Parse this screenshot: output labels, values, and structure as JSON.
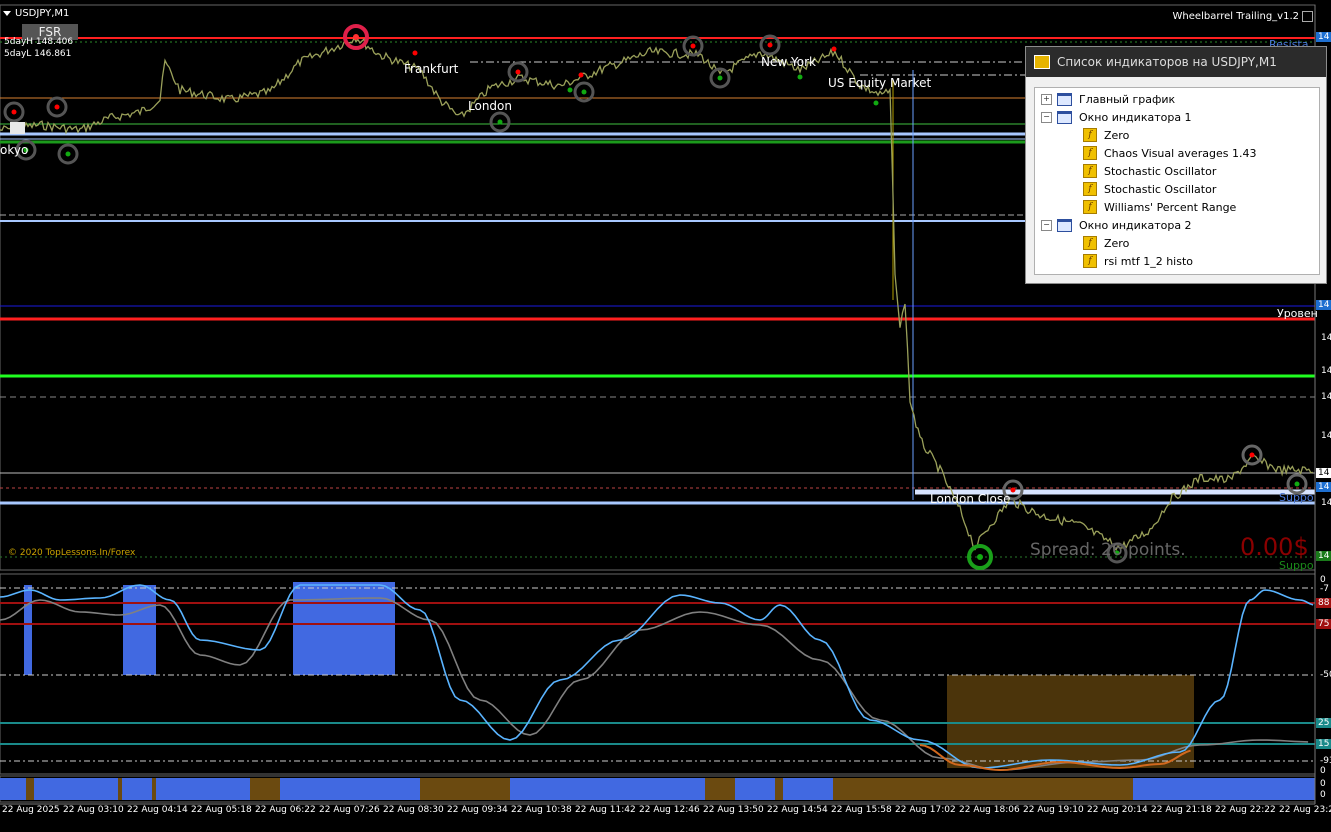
{
  "window": {
    "symbol_title": "USDJPY,M1",
    "fsr_label": "FSR",
    "five_day_high": "5dayH 148.406",
    "five_day_low": "5dayL 146.861",
    "ea_name": "Wheelbarrel Trailing_v1.2",
    "copyright": "© 2020 TopLessons.In/Forex",
    "spread": "Spread: 26 points.",
    "profit": "0.00$"
  },
  "sessions": {
    "tokyo": "okyo",
    "frankfurt": "Frankfurt",
    "london": "London",
    "new_york": "New York",
    "us_equity": "US Equity Market",
    "london_close": "London Close"
  },
  "levels": {
    "resistance": "Resista",
    "uroven": "Уровен",
    "support_1": "Suppo",
    "support_2": "Suppo"
  },
  "price_axis_tags": {
    "t1": "14",
    "t2": "14",
    "t3": "14",
    "t4": "14",
    "t5": "14",
    "t6": "14",
    "t7": "14",
    "t8": "14",
    "t9": "14",
    "t10": "14"
  },
  "sub_axis": [
    "0",
    "-7",
    "88",
    "75",
    "-50",
    "25",
    "15",
    "-93",
    "0",
    "0",
    "0"
  ],
  "indicator_list": {
    "title": "Список индикаторов на USDJPY,M1",
    "items": [
      {
        "label": "Главный график",
        "kind": "window",
        "level": 0
      },
      {
        "label": "Окно индикатора 1",
        "kind": "window",
        "level": 0
      },
      {
        "label": "Zero",
        "kind": "indicator",
        "level": 1
      },
      {
        "label": "Chaos Visual averages 1.43",
        "kind": "indicator",
        "level": 1
      },
      {
        "label": "Stochastic Oscillator",
        "kind": "indicator",
        "level": 1
      },
      {
        "label": "Stochastic Oscillator",
        "kind": "indicator",
        "level": 1
      },
      {
        "label": "Williams' Percent Range",
        "kind": "indicator",
        "level": 1
      },
      {
        "label": "Окно индикатора 2",
        "kind": "window",
        "level": 0
      },
      {
        "label": "Zero",
        "kind": "indicator",
        "level": 1
      },
      {
        "label": "rsi mtf 1_2 histo",
        "kind": "indicator",
        "level": 1
      }
    ]
  },
  "time_axis": [
    "22 Aug 2025",
    "22 Aug 03:10",
    "22 Aug 04:14",
    "22 Aug 05:18",
    "22 Aug 06:22",
    "22 Aug 07:26",
    "22 Aug 08:30",
    "22 Aug 09:34",
    "22 Aug 10:38",
    "22 Aug 11:42",
    "22 Aug 12:46",
    "22 Aug 13:50",
    "22 Aug 14:54",
    "22 Aug 15:58",
    "22 Aug 17:02",
    "22 Aug 18:06",
    "22 Aug 19:10",
    "22 Aug 20:14",
    "22 Aug 21:18",
    "22 Aug 22:22",
    "22 Aug 23:26"
  ],
  "colors": {
    "background": "#000000",
    "price_line": "#9aa05a",
    "resistance": "#ff2020",
    "support": "#a8c8ff",
    "green_level": "#20ff20",
    "histo_blue": "#4169e1",
    "histo_brown": "#6b4a10",
    "stoch_fast": "#5ab4ff",
    "stoch_slow": "#808080",
    "rsi_orange": "#d2691e"
  }
}
